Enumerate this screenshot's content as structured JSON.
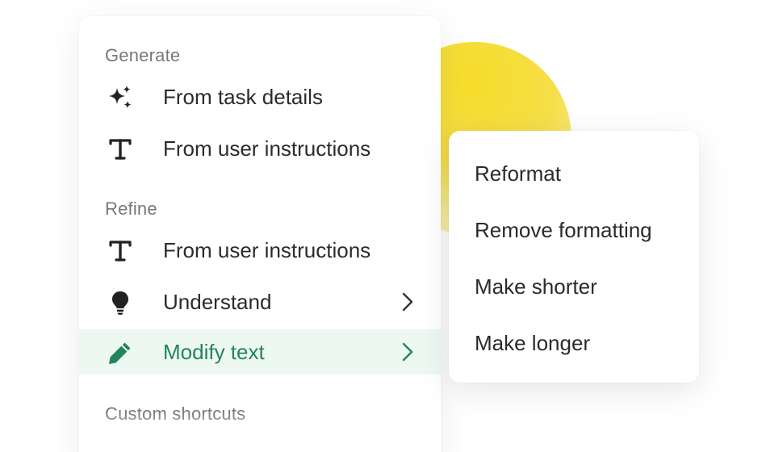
{
  "menu": {
    "sections": {
      "generate": "Generate",
      "refine": "Refine",
      "custom": "Custom shortcuts"
    },
    "items": [
      {
        "label": "From task details",
        "icon": "sparkles-icon"
      },
      {
        "label": "From user instructions",
        "icon": "text-icon"
      },
      {
        "label": "From user instructions",
        "icon": "text-icon"
      },
      {
        "label": "Understand",
        "icon": "lightbulb-icon",
        "has_submenu": true
      },
      {
        "label": "Modify text",
        "icon": "pencil-icon",
        "has_submenu": true,
        "active": true
      }
    ]
  },
  "submenu": {
    "items": [
      "Reformat",
      "Remove formatting",
      "Make shorter",
      "Make longer"
    ]
  },
  "colors": {
    "accent": "#23855a",
    "active_bg": "#eef8f3",
    "sun": "#f7dc2a",
    "text": "#2b2b2b",
    "section_text": "#787878"
  }
}
